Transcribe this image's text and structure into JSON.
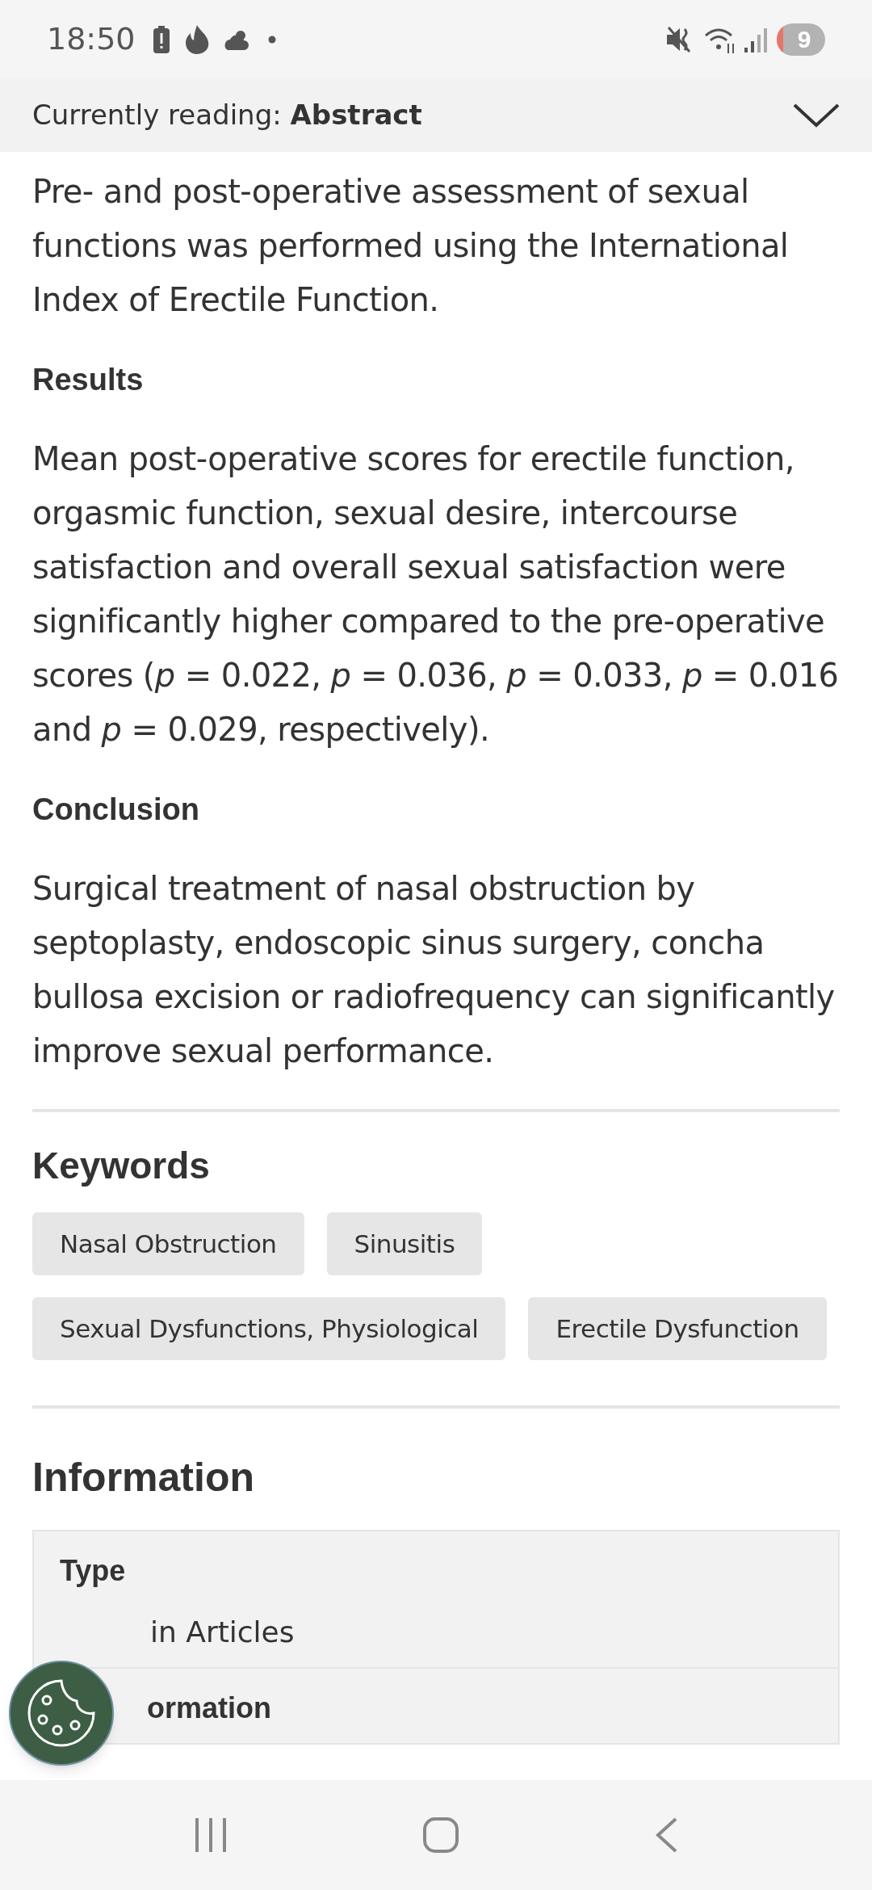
{
  "status_bar": {
    "time": "18:50",
    "notification_count": "9"
  },
  "reading_bar": {
    "label": "Currently reading:",
    "section": "Abstract"
  },
  "abstract": [
    {
      "kind": "paragraph",
      "text": "Pre- and post-operative assessment of sexual functions was performed using the International Index of Erectile Function."
    },
    {
      "kind": "heading",
      "text": "Results"
    },
    {
      "kind": "paragraph",
      "text": "Mean post-operative scores for erectile function, orgasmic function, sexual desire, intercourse satisfaction and overall sexual satisfaction were significantly higher compared to the pre-operative scores (*p* = 0.022, *p* = 0.036, *p* = 0.033, *p* = 0.016 and *p* = 0.029, respectively)."
    },
    {
      "kind": "heading",
      "text": "Conclusion"
    },
    {
      "kind": "paragraph",
      "text": "Surgical treatment of nasal obstruction by septoplasty, endoscopic sinus surgery, concha bullosa excision or radiofrequency can significantly improve sexual performance."
    }
  ],
  "keywords": {
    "title": "Keywords",
    "items": [
      "Nasal Obstruction",
      "Sinusitis",
      "Sexual Dysfunctions, Physiological",
      "Erectile Dysfunction"
    ]
  },
  "information": {
    "title": "Information",
    "rows": [
      {
        "label": "Type",
        "value": "in Articles"
      },
      {
        "label": "ormation"
      }
    ]
  }
}
